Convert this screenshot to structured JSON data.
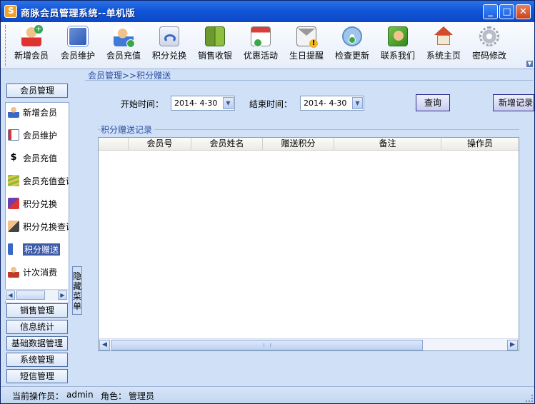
{
  "window": {
    "title": "商脉会员管理系统--单机版"
  },
  "toolbar": {
    "items": [
      {
        "label": "新增会员",
        "icon": "add-member-icon"
      },
      {
        "label": "会员维护",
        "icon": "member-card-icon"
      },
      {
        "label": "会员充值",
        "icon": "recharge-icon"
      },
      {
        "label": "积分兑换",
        "icon": "points-exchange-icon"
      },
      {
        "label": "销售收银",
        "icon": "cashier-icon"
      },
      {
        "label": "优惠活动",
        "icon": "calendar-icon"
      },
      {
        "label": "生日提醒",
        "icon": "mail-reminder-icon"
      },
      {
        "label": "检查更新",
        "icon": "cd-update-icon"
      },
      {
        "label": "联系我们",
        "icon": "contact-icon"
      },
      {
        "label": "系统主页",
        "icon": "home-icon"
      },
      {
        "label": "密码修改",
        "icon": "gear-password-icon"
      }
    ]
  },
  "sidebar": {
    "groups": [
      {
        "label": "会员管理"
      },
      {
        "label": "销售管理"
      },
      {
        "label": "信息统计"
      },
      {
        "label": "基础数据管理"
      },
      {
        "label": "系统管理"
      },
      {
        "label": "短信管理"
      }
    ],
    "items": [
      {
        "label": "新增会员",
        "icon": "person-icon"
      },
      {
        "label": "会员维护",
        "icon": "card-icon"
      },
      {
        "label": "会员充值",
        "icon": "dollar-icon"
      },
      {
        "label": "会员充值查询",
        "icon": "money-stack-icon"
      },
      {
        "label": "积分兑换",
        "icon": "exchange-icon"
      },
      {
        "label": "积分兑换查询",
        "icon": "search-exchange-icon"
      },
      {
        "label": "积分赠送",
        "icon": "gift-points-icon",
        "selected": true
      },
      {
        "label": "计次消费",
        "icon": "count-consume-icon"
      }
    ],
    "hide_menu": "隐藏菜单"
  },
  "main": {
    "breadcrumb": "会员管理>>积分赠送",
    "start_label": "开始时间：",
    "start_value": "2014- 4-30",
    "end_label": "结束时间：",
    "end_value": "2014- 4-30",
    "query_button": "查询",
    "add_button": "新增记录",
    "section_title": "积分赠送记录",
    "columns": [
      "会员号",
      "会员姓名",
      "赠送积分",
      "备注",
      "操作员"
    ],
    "rows": []
  },
  "status": {
    "operator_label": "当前操作员：",
    "operator": "admin",
    "role_label": "角色：",
    "role": "管理员"
  },
  "colors": {
    "titlebar": "#1256d8",
    "background": "#cfe0f7",
    "selected": "#3b5aa8",
    "accent_text": "#2d4fa2"
  }
}
